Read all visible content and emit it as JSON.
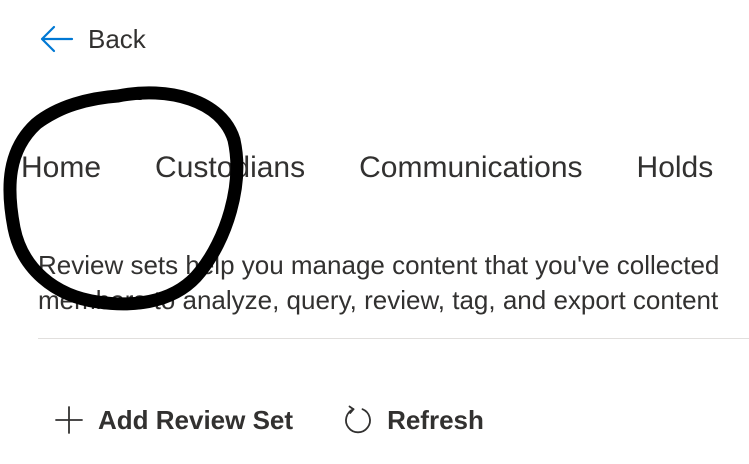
{
  "nav": {
    "back_label": "Back",
    "accent_color": "#0078d4"
  },
  "tabs": [
    {
      "label": "Home"
    },
    {
      "label": "Custodians"
    },
    {
      "label": "Communications"
    },
    {
      "label": "Holds"
    }
  ],
  "description": {
    "line1": "Review sets help you manage content that you've collected",
    "line2": "members to analyze, query, review, tag, and export content"
  },
  "commands": {
    "add_review_set_label": "Add Review Set",
    "add_icon": "plus-icon",
    "refresh_label": "Refresh",
    "refresh_icon": "refresh-icon"
  },
  "annotation": {
    "type": "hand-drawn-circle",
    "color": "#000000"
  }
}
